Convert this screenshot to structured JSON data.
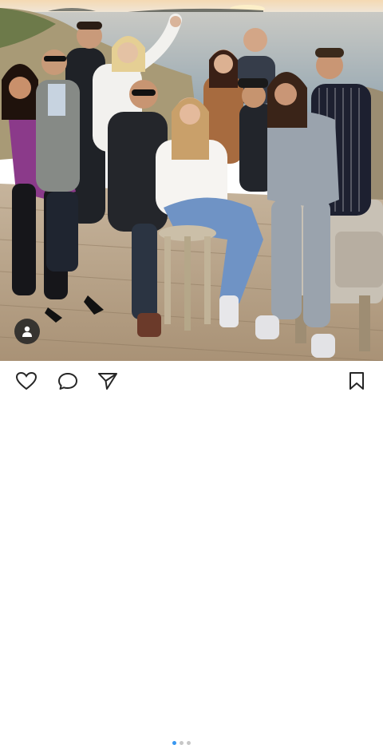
{
  "post": {
    "image_alt_icon": "person-tag-icon",
    "carousel": {
      "count": 3,
      "active_index": 0
    }
  },
  "actions": {
    "like_icon": "heart-icon",
    "comment_icon": "comment-bubble-icon",
    "share_icon": "paper-plane-icon",
    "save_icon": "bookmark-icon"
  },
  "colors": {
    "accent": "#3897f0",
    "icon": "#262626",
    "sea": "#9fb2bf",
    "deck": "#b9a48a"
  }
}
